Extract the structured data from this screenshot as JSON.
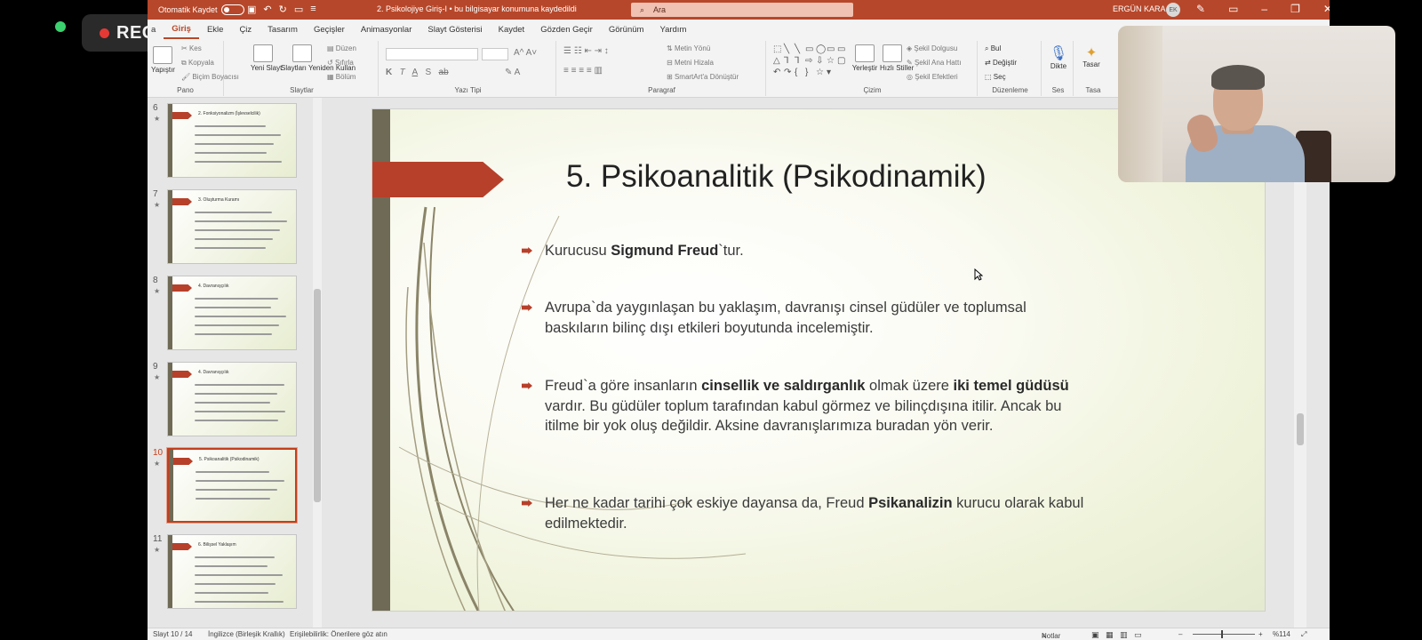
{
  "recorder": {
    "label": "REC"
  },
  "titlebar": {
    "autosave_label": "Otomatik Kaydet",
    "document": "2. Psikolojiye Giriş-I  •  bu bilgisayar konumuna kaydedildi",
    "search_placeholder": "Ara",
    "user_name": "ERGÜN KARA",
    "user_initials": "EK"
  },
  "tabs": [
    "a",
    "Giriş",
    "Ekle",
    "Çiz",
    "Tasarım",
    "Geçişler",
    "Animasyonlar",
    "Slayt Gösterisi",
    "Kaydet",
    "Gözden Geçir",
    "Görünüm",
    "Yardım"
  ],
  "active_tab": "Giriş",
  "ribbon": {
    "pano": {
      "label": "Pano",
      "paste": "Yapıştır",
      "cut": "Kes",
      "copy": "Kopyala",
      "format_painter": "Biçim Boyacısı"
    },
    "slaytlar": {
      "label": "Slaytlar",
      "new_slide": "Yeni Slayt",
      "reuse": "Slaytları Yeniden Kullan",
      "layout": "Düzen",
      "reset": "Sıfırla",
      "section": "Bölüm"
    },
    "yazi_tipi": {
      "label": "Yazı Tipi",
      "bold": "K",
      "italic": "T",
      "underline": "A",
      "strike": "S",
      "ab": "ab"
    },
    "paragraf": {
      "label": "Paragraf",
      "text_direction": "Metin Yönü",
      "align_text": "Metni Hizala",
      "smartart": "SmartArt'a Dönüştür"
    },
    "cizim": {
      "label": "Çizim",
      "arrange": "Yerleştir",
      "quick_styles": "Hızlı Stiller",
      "shape_fill": "Şekil Dolgusu",
      "shape_outline": "Şekil Ana Hattı",
      "shape_effects": "Şekil Efektleri"
    },
    "duzenleme": {
      "label": "Düzenleme",
      "find": "Bul",
      "replace": "Değiştir",
      "select": "Seç"
    },
    "ses": {
      "label": "Ses",
      "dictate": "Dikte"
    },
    "tasarimci": {
      "label": "Tasa",
      "button": "Tasar"
    }
  },
  "thumbnails": [
    {
      "num": "6",
      "title": "2. Fonksiyonalizm (İşlevselcilik)",
      "lines": 5
    },
    {
      "num": "7",
      "title": "3. Oluşturma Kuramı",
      "lines": 5
    },
    {
      "num": "8",
      "title": "4. Davranışçılık",
      "lines": 5
    },
    {
      "num": "9",
      "title": "4. Davranışçılık",
      "lines": 5
    },
    {
      "num": "10",
      "title": "5. Psikoanalitik (Psikodinamik)",
      "lines": 4,
      "selected": true
    },
    {
      "num": "11",
      "title": "6. Bilişsel Yaklaşım",
      "lines": 6
    }
  ],
  "slide": {
    "title": "5. Psikoanalitik (Psikodinamik)",
    "bullets": [
      {
        "segments": [
          {
            "t": "Kurucusu "
          },
          {
            "t": "Sigmund Freud",
            "b": true
          },
          {
            "t": "`tur."
          }
        ]
      },
      {
        "segments": [
          {
            "t": "Avrupa`da yaygınlaşan bu yaklaşım, davranışı cinsel güdüler ve toplumsal baskıların bilinç dışı etkileri boyutunda incelemiştir."
          }
        ]
      },
      {
        "segments": [
          {
            "t": "Freud`a göre insanların "
          },
          {
            "t": "cinsellik ve saldırganlık",
            "b": true
          },
          {
            "t": " olmak üzere "
          },
          {
            "t": "iki temel güdüsü",
            "b": true
          },
          {
            "t": " vardır. Bu güdüler toplum tarafından kabul görmez ve bilinçdışına itilir. Ancak bu itilme bir yok oluş değildir. Aksine davranışlarımıza buradan yön verir."
          }
        ]
      },
      {
        "segments": [
          {
            "t": "Her ne kadar tarihi çok eskiye dayansa da, Freud "
          },
          {
            "t": "Psikanalizin",
            "b": true
          },
          {
            "t": " kurucu olarak kabul edilmektedir."
          }
        ]
      }
    ]
  },
  "statusbar": {
    "slide_of": "Slayt 10 / 14",
    "language": "İngilizce (Birleşik Krallık)",
    "accessibility": "Erişilebilirlik: Önerilere göz atın",
    "notes": "Notlar",
    "zoom": "%114"
  },
  "colors": {
    "accent": "#b7472a",
    "slide_bar": "#6f6a55",
    "bullet": "#b7402a"
  }
}
